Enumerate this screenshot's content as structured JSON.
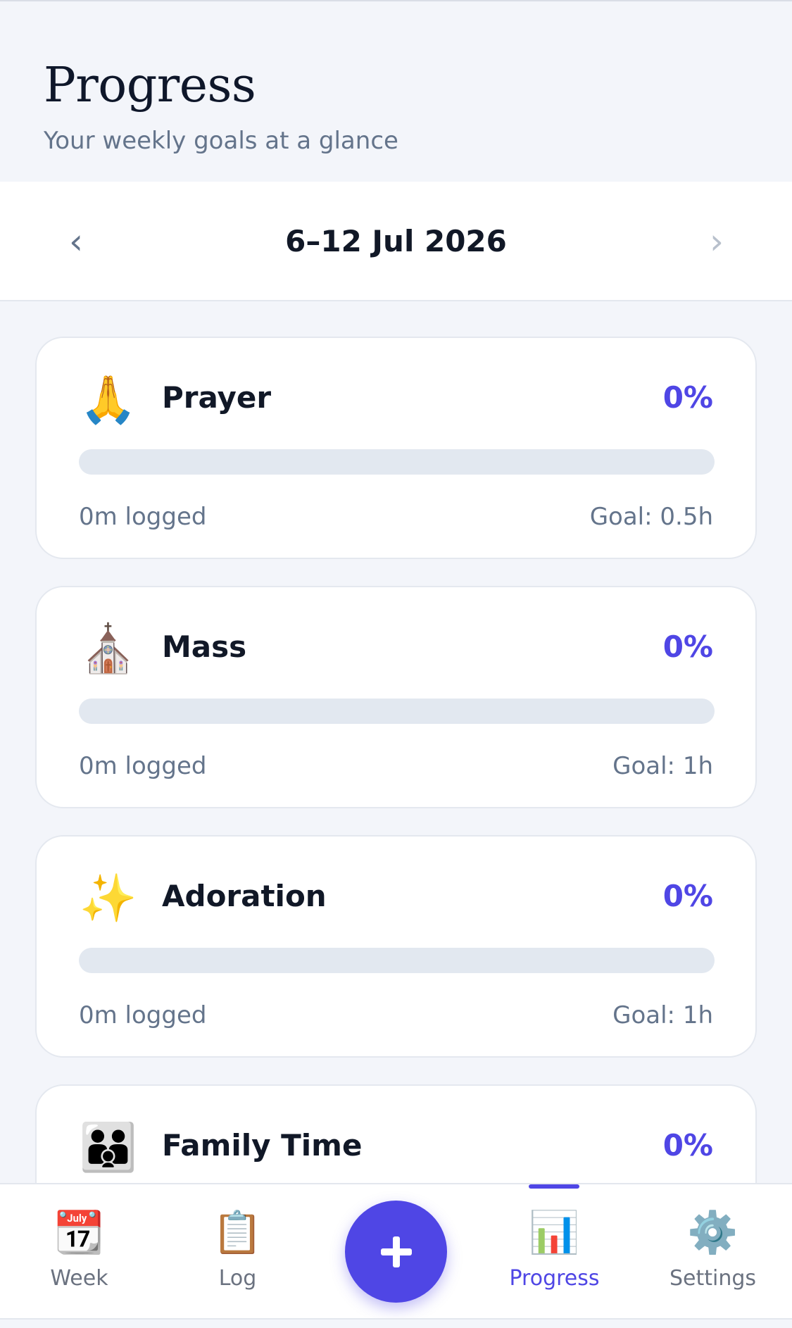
{
  "header": {
    "title": "Progress",
    "subtitle": "Your weekly goals at a glance"
  },
  "week": {
    "prev_icon": "chevron-left-icon",
    "next_icon": "chevron-right-icon",
    "label": "6–12 Jul 2026"
  },
  "goals": [
    {
      "emoji": "🙏",
      "icon": "praying-hands-icon",
      "name": "Prayer",
      "percent": "0%",
      "progress": 0,
      "logged": "0m logged",
      "goal": "Goal: 0.5h"
    },
    {
      "emoji": "⛪",
      "icon": "church-icon",
      "name": "Mass",
      "percent": "0%",
      "progress": 0,
      "logged": "0m logged",
      "goal": "Goal: 1h"
    },
    {
      "emoji": "✨",
      "icon": "sparkles-icon",
      "name": "Adoration",
      "percent": "0%",
      "progress": 0,
      "logged": "0m logged",
      "goal": "Goal: 1h"
    },
    {
      "emoji": "👪",
      "icon": "family-icon",
      "name": "Family Time",
      "percent": "0%",
      "progress": 0
    }
  ],
  "tabs": [
    {
      "label": "Week",
      "icon": "calendar-icon",
      "glyph": "📆",
      "active": false
    },
    {
      "label": "Log",
      "icon": "clipboard-icon",
      "glyph": "📋",
      "active": false
    },
    {
      "label": "Progress",
      "icon": "bar-chart-icon",
      "glyph": "📊",
      "active": true
    },
    {
      "label": "Settings",
      "icon": "gear-icon",
      "glyph": "⚙️",
      "active": false
    }
  ],
  "fab": {
    "icon": "plus-icon"
  },
  "colors": {
    "accent": "#4f46e5",
    "muted_text": "#64748b",
    "track": "#e2e8f0",
    "background": "#f3f5fa"
  }
}
